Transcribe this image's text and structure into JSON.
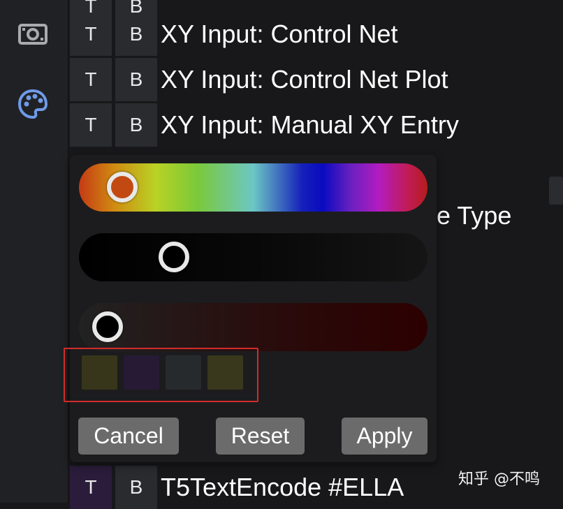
{
  "sidebar": {
    "icons": [
      "camera-icon",
      "palette-icon"
    ],
    "palette_icon_color": "#6f9ae8"
  },
  "nodes": [
    {
      "t_label": "T",
      "b_label": "B",
      "title": ""
    },
    {
      "t_label": "T",
      "b_label": "B",
      "title": "XY Input: Control Net"
    },
    {
      "t_label": "T",
      "b_label": "B",
      "title": "XY Input: Control Net Plot"
    },
    {
      "t_label": "T",
      "b_label": "B",
      "title": "XY Input: Manual XY Entry"
    },
    {
      "t_label": "T",
      "b_label": "B",
      "title": "T5TextEncode #ELLA"
    }
  ],
  "partial_node_text": "e Type",
  "color_picker": {
    "hue_fraction": 0.07,
    "saturation_fraction": 0.24,
    "value_fraction": 0.02,
    "swatches": [
      "#38361a",
      "#261a35",
      "#272a2c",
      "#39381c"
    ],
    "buttons": {
      "cancel": "Cancel",
      "reset": "Reset",
      "apply": "Apply"
    }
  },
  "watermark": "知乎 @不鸣"
}
